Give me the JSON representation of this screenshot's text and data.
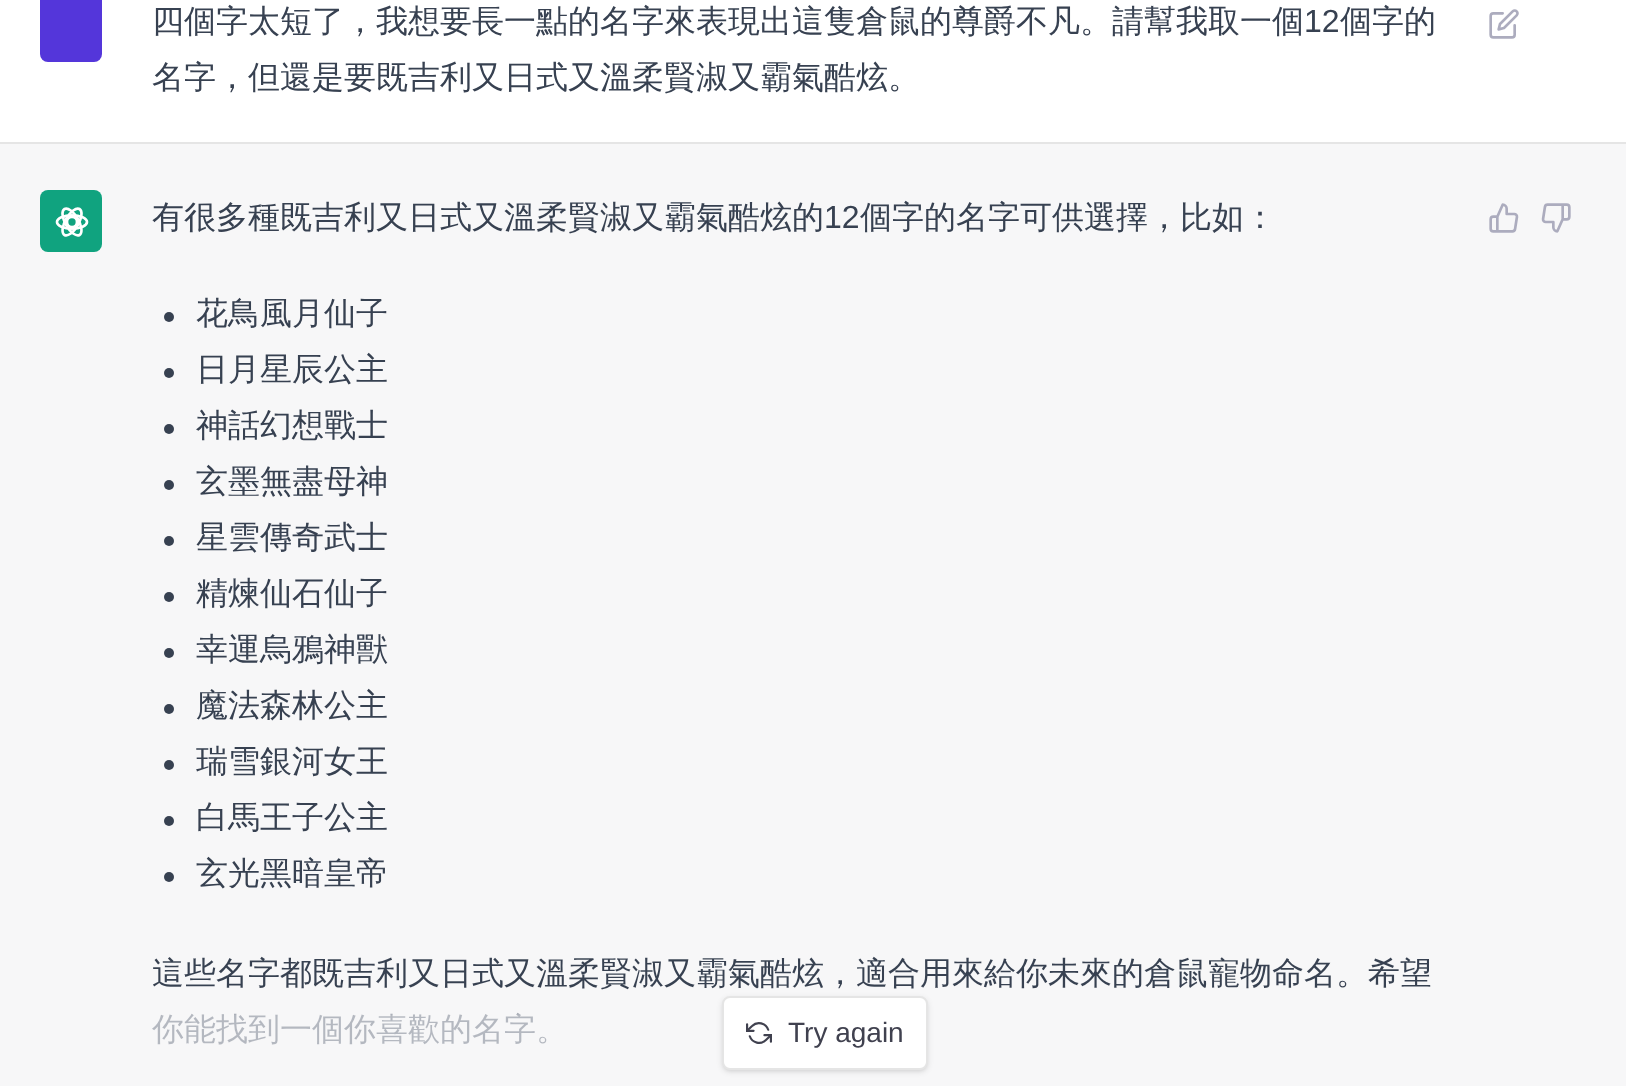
{
  "user_message": {
    "text": "四個字太短了，我想要長一點的名字來表現出這隻倉鼠的尊爵不凡。請幫我取一個12個字的名字，但還是要既吉利又日式又溫柔賢淑又霸氣酷炫。"
  },
  "assistant_message": {
    "intro": "有很多種既吉利又日式又溫柔賢淑又霸氣酷炫的12個字的名字可供選擇，比如：",
    "names": [
      "花鳥風月仙子",
      "日月星辰公主",
      "神話幻想戰士",
      "玄墨無盡母神",
      "星雲傳奇武士",
      "精煉仙石仙子",
      "幸運烏鴉神獸",
      "魔法森林公主",
      "瑞雪銀河女王",
      "白馬王子公主",
      "玄光黑暗皇帝"
    ],
    "closing": "這些名字都既吉利又日式又溫柔賢淑又霸氣酷炫，適合用來給你未來的倉鼠寵物命名。希望你能找到一個你喜歡的名字。"
  },
  "try_again_button": {
    "label": "Try again"
  }
}
